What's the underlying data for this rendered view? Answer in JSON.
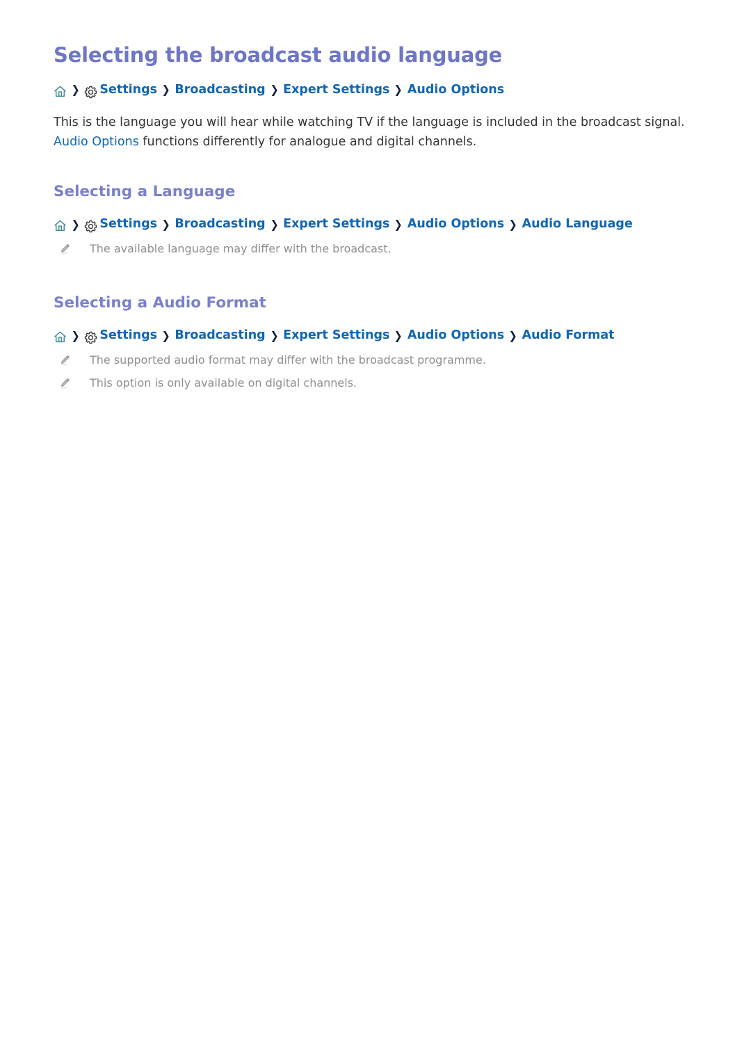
{
  "page": {
    "title": "Selecting the broadcast audio language",
    "background": "#ffffff"
  },
  "colors": {
    "title": "#6e76c6",
    "heading": "#7a81cb",
    "link": "#1266b2",
    "body": "#333333",
    "note": "#8e8e93",
    "separator": "#14213d",
    "home_icon": "#3f8c96",
    "gear_icon": "#3a3a3a",
    "pencil_icon": "#9a9a9a"
  },
  "main_breadcrumb": {
    "home_icon": "home-icon",
    "gear_icon": "gear-icon",
    "separator": "❯",
    "crumbs": [
      "Settings",
      "Broadcasting",
      "Expert Settings",
      "Audio Options"
    ]
  },
  "intro": {
    "line1": "This is the language you will hear while watching TV if the language is included in the broadcast signal.",
    "link": "Audio Options",
    "line2": " functions differently for analogue and digital channels."
  },
  "sections": [
    {
      "heading": "Selecting a Language",
      "breadcrumb": {
        "home_icon": "home-icon",
        "gear_icon": "gear-icon",
        "separator": "❯",
        "crumbs": [
          "Settings",
          "Broadcasting",
          "Expert Settings",
          "Audio Options",
          "Audio Language"
        ]
      },
      "notes": [
        "The available language may differ with the broadcast."
      ]
    },
    {
      "heading": "Selecting a Audio Format",
      "breadcrumb": {
        "home_icon": "home-icon",
        "gear_icon": "gear-icon",
        "separator": "❯",
        "crumbs": [
          "Settings",
          "Broadcasting",
          "Expert Settings",
          "Audio Options",
          "Audio Format"
        ]
      },
      "notes": [
        "The supported audio format may differ with the broadcast programme.",
        "This option is only available on digital channels."
      ]
    }
  ]
}
